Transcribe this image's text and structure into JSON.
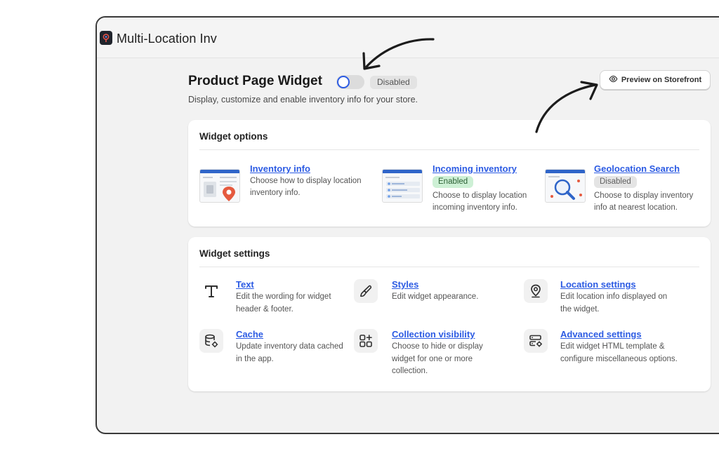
{
  "app": {
    "title": "Multi-Location Inv"
  },
  "header": {
    "title": "Product Page Widget",
    "status_badge": "Disabled",
    "subtitle": "Display, customize and enable inventory info for your store.",
    "preview_button_label": "Preview on Storefront"
  },
  "widget_options": {
    "heading": "Widget options",
    "items": [
      {
        "title": "Inventory info",
        "badge": "",
        "description": "Choose how to display location inventory info."
      },
      {
        "title": "Incoming inventory",
        "badge": "Enabled",
        "description": "Choose to display location incoming inventory info."
      },
      {
        "title": "Geolocation Search",
        "badge": "Disabled",
        "description": "Choose to display inventory info at nearest location."
      }
    ]
  },
  "widget_settings": {
    "heading": "Widget settings",
    "items": [
      {
        "title": "Text",
        "description": "Edit the wording for widget header & footer.",
        "icon": "text-icon"
      },
      {
        "title": "Styles",
        "description": "Edit widget appearance.",
        "icon": "brush-icon"
      },
      {
        "title": "Location settings",
        "description": "Edit location info displayed on the widget.",
        "icon": "location-pin-icon"
      },
      {
        "title": "Cache",
        "description": "Update inventory data cached in the app.",
        "icon": "database-gear-icon"
      },
      {
        "title": "Collection visibility",
        "description": "Choose to hide or display widget for one or more collection.",
        "icon": "apps-add-icon"
      },
      {
        "title": "Advanced settings",
        "description": "Edit widget HTML template & configure miscellaneous options.",
        "icon": "server-gear-icon"
      }
    ]
  },
  "colors": {
    "link": "#2c5be3",
    "enabled_badge_bg": "#cdf0d5",
    "disabled_badge_bg": "#e3e3e3",
    "toggle_off": "#dcdcdc"
  }
}
